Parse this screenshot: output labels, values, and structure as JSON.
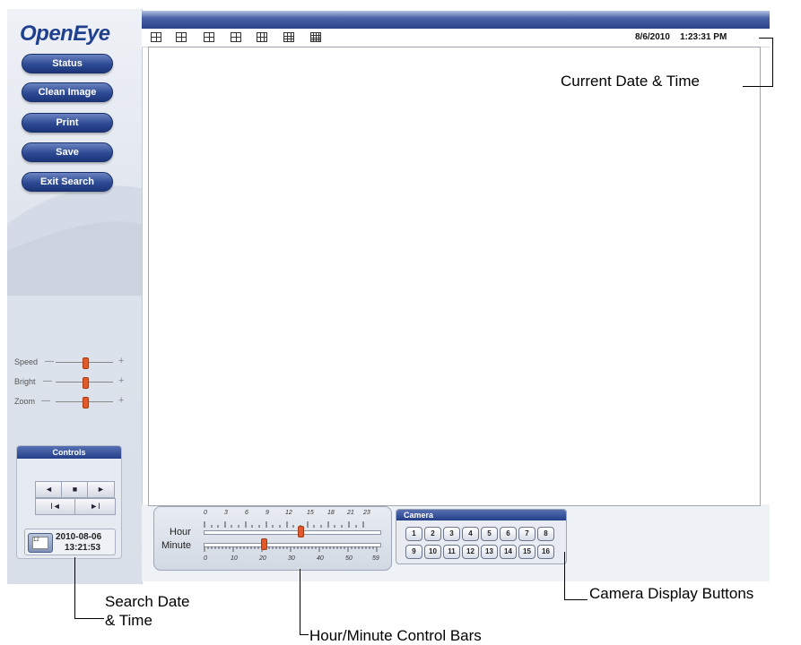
{
  "app": {
    "logo": "OpenEye"
  },
  "sidebar": {
    "buttons": [
      {
        "label": "Status"
      },
      {
        "label": "Clean Image"
      },
      {
        "label": "Print"
      },
      {
        "label": "Save"
      },
      {
        "label": "Exit Search"
      }
    ],
    "sliders": [
      {
        "label": "Speed",
        "level": 0.5
      },
      {
        "label": "Bright",
        "level": 0.5
      },
      {
        "label": "Zoom",
        "level": 0.5
      }
    ],
    "controls": {
      "title": "Controls",
      "buttons": [
        "◄",
        "■",
        "►",
        "I◄",
        "►I"
      ],
      "calendar_icon_text": "12",
      "search_date": "2010-08-06",
      "search_time": "13:21:53"
    }
  },
  "toolbar": {
    "layout_icons": [
      "layout-1-icon",
      "layout-2-icon",
      "layout-3-icon",
      "layout-4-icon",
      "layout-5-icon",
      "layout-6-icon",
      "layout-7-icon"
    ],
    "date": "8/6/2010",
    "time": "1:23:31 PM"
  },
  "hour_minute": {
    "hour_label": "Hour",
    "minute_label": "Minute",
    "hour_ticks": [
      "0",
      "3",
      "6",
      "9",
      "12",
      "15",
      "18",
      "21",
      "23"
    ],
    "minute_ticks": [
      "0",
      "10",
      "20",
      "30",
      "40",
      "50",
      "59"
    ],
    "hour_value": 13,
    "minute_value": 21
  },
  "camera": {
    "title": "Camera",
    "buttons": [
      "1",
      "2",
      "3",
      "4",
      "5",
      "6",
      "7",
      "8",
      "9",
      "10",
      "11",
      "12",
      "13",
      "14",
      "15",
      "16"
    ]
  },
  "annotations": {
    "current_datetime": "Current Date & Time",
    "search_line1": "Search Date",
    "search_line2": "& Time",
    "hour_minute": "Hour/Minute Control Bars",
    "camera_buttons": "Camera Display Buttons"
  },
  "colors": {
    "brand_blue": "#1f3f8f",
    "button_blue": "#2d4a93",
    "slider_thumb": "#e05a2b"
  }
}
